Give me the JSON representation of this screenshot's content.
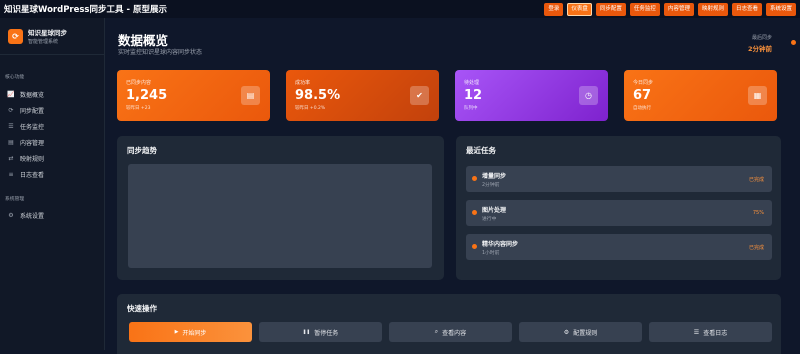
{
  "app": {
    "title": "知识星球WordPress同步工具 - 原型展示"
  },
  "topnav": [
    {
      "label": "登录",
      "active": false
    },
    {
      "label": "仪表盘",
      "active": true
    },
    {
      "label": "同步配置",
      "active": false
    },
    {
      "label": "任务监控",
      "active": false
    },
    {
      "label": "内容管理",
      "active": false
    },
    {
      "label": "映射规则",
      "active": false
    },
    {
      "label": "日志查看",
      "active": false
    },
    {
      "label": "系统设置",
      "active": false
    }
  ],
  "sidebar": {
    "brand_name": "知识星球同步",
    "brand_sub": "智能管理系统",
    "section_core": "核心功能",
    "items": [
      {
        "label": "数据概览",
        "icon": "chart-line-icon",
        "glyph": "📈"
      },
      {
        "label": "同步配置",
        "icon": "sync-icon",
        "glyph": "⟳"
      },
      {
        "label": "任务监控",
        "icon": "tasks-icon",
        "glyph": "☰"
      },
      {
        "label": "内容管理",
        "icon": "file-icon",
        "glyph": "▤"
      },
      {
        "label": "映射规则",
        "icon": "exchange-icon",
        "glyph": "⇄"
      },
      {
        "label": "日志查看",
        "icon": "list-icon",
        "glyph": "≡"
      }
    ],
    "section_system": "系统管理",
    "system_items": [
      {
        "label": "系统设置",
        "icon": "gear-icon",
        "glyph": "⚙"
      }
    ]
  },
  "main": {
    "title": "数据概览",
    "subtitle": "实时监控知识星球内容同步状态",
    "last_sync_label": "最后同步",
    "last_sync_value": "2分钟前"
  },
  "stats": [
    {
      "label": "已同步内容",
      "value": "1,245",
      "note": "较昨日 +23",
      "color": "#f97316",
      "icon": "document-icon",
      "glyph": "▤"
    },
    {
      "label": "成功率",
      "value": "98.5%",
      "note": "较昨日 +0.2%",
      "color": "#ea580c",
      "icon": "check-circle-icon",
      "glyph": "✔"
    },
    {
      "label": "待处理",
      "value": "12",
      "note": "队列中",
      "color": "#9333ea",
      "icon": "clock-icon",
      "glyph": "◷"
    },
    {
      "label": "今日同步",
      "value": "67",
      "note": "自动执行",
      "color": "#f97316",
      "icon": "calendar-icon",
      "glyph": "▦"
    }
  ],
  "trend": {
    "title": "同步趋势"
  },
  "recent": {
    "title": "最近任务",
    "tasks": [
      {
        "name": "增量同步",
        "meta": "2分钟前",
        "status": "已完成"
      },
      {
        "name": "图片处理",
        "meta": "进行中",
        "status": "75%"
      },
      {
        "name": "精华内容同步",
        "meta": "1小时前",
        "status": "已完成"
      }
    ]
  },
  "quick": {
    "title": "快速操作",
    "actions": [
      {
        "label": "开始同步",
        "icon": "play-icon",
        "glyph": "▶"
      },
      {
        "label": "暂停任务",
        "icon": "pause-icon",
        "glyph": "❚❚"
      },
      {
        "label": "查看内容",
        "icon": "search-icon",
        "glyph": "⌕"
      },
      {
        "label": "配置规则",
        "icon": "gear-icon",
        "glyph": "⚙"
      },
      {
        "label": "查看日志",
        "icon": "list-icon",
        "glyph": "☰"
      }
    ]
  }
}
